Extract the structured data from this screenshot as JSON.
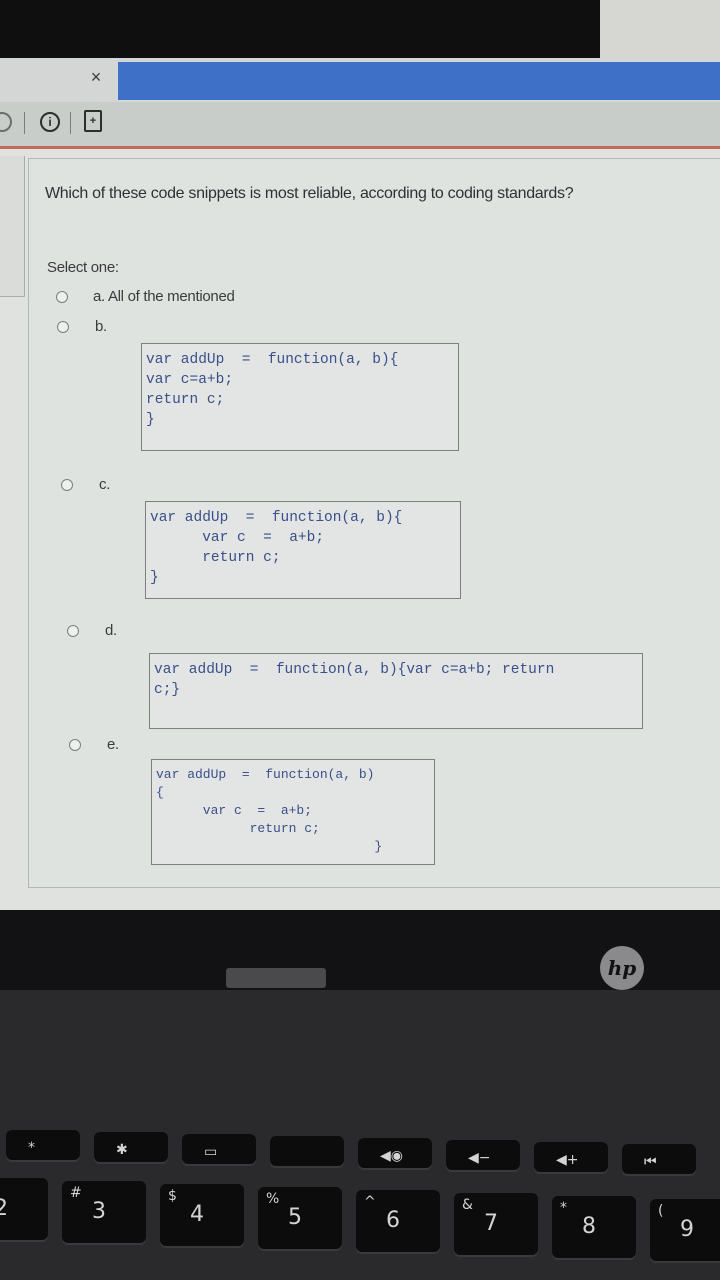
{
  "window": {
    "tab_close_glyph": "×"
  },
  "toolbar": {
    "info_glyph": "i",
    "doc_glyph": "+"
  },
  "quiz": {
    "question": "Which of these code snippets is most reliable, according to coding standards?",
    "select_prompt": "Select one:",
    "options": [
      {
        "label": "a. All of the mentioned"
      },
      {
        "label": "b.",
        "code": [
          "var addUp  =  function(a, b){",
          "var c=a+b;",
          "return c;",
          "}"
        ]
      },
      {
        "label": "c.",
        "code": [
          "var addUp  =  function(a, b){",
          "      var c  =  a+b;",
          "      return c;",
          "}"
        ]
      },
      {
        "label": "d.",
        "code": [
          "var addUp  =  function(a, b){var c=a+b; return",
          "c;}"
        ]
      },
      {
        "label": "e.",
        "code": [
          "var addUp  =  function(a, b)",
          "{",
          "      var c  =  a+b;",
          "            return c;",
          "                            }"
        ]
      }
    ]
  },
  "laptop": {
    "brand": "hp",
    "fkeys": [
      "*",
      "✱",
      "▭",
      "",
      "◀◉",
      "◀−",
      "◀+",
      "⏮"
    ],
    "numkeys": [
      {
        "top": "@",
        "main": "2"
      },
      {
        "top": "#",
        "main": "3"
      },
      {
        "top": "$",
        "main": "4"
      },
      {
        "top": "%",
        "main": "5"
      },
      {
        "top": "^",
        "main": "6"
      },
      {
        "top": "&",
        "main": "7"
      },
      {
        "top": "*",
        "main": "8"
      },
      {
        "top": "(",
        "main": "9"
      }
    ]
  },
  "colors": {
    "tab_active": "#3e70c7",
    "accent_rule": "#c36a5b",
    "code_text": "#3b4f8a"
  }
}
